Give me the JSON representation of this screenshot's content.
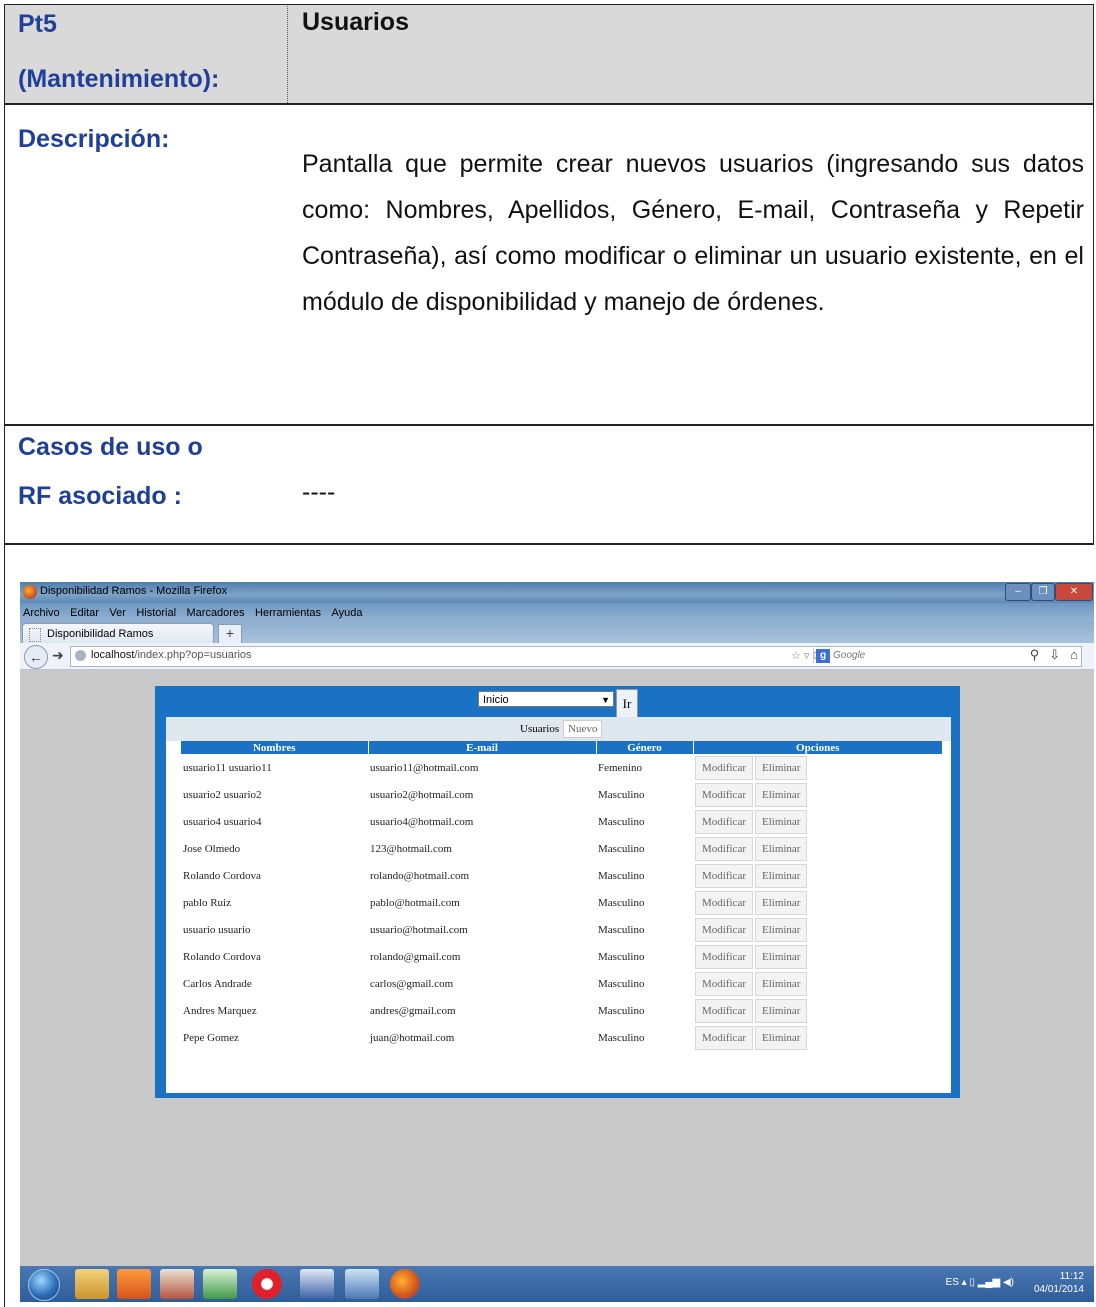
{
  "document": {
    "pt_label_line1": "Pt5",
    "pt_label_line2": "(Mantenimiento):",
    "title": "Usuarios",
    "desc_label": "Descripción:",
    "description": "Pantalla que permite crear nuevos usuarios (ingresando sus datos como: Nombres, Apellidos, Género, E-mail, Contraseña y Repetir Contraseña), así como modificar o eliminar un usuario existente, en el módulo de disponibilidad y manejo de órdenes.",
    "rf_label_line1": "Casos de uso o",
    "rf_label_line2": "RF asociado :",
    "rf_value": "----"
  },
  "browser": {
    "window_title": "Disponibilidad Ramos - Mozilla Firefox",
    "menu": [
      "Archivo",
      "Editar",
      "Ver",
      "Historial",
      "Marcadores",
      "Herramientas",
      "Ayuda"
    ],
    "tab_label": "Disponibilidad Ramos",
    "url_host": "localhost",
    "url_path": "/index.php?op=usuarios",
    "search_placeholder": "Google"
  },
  "app": {
    "menu_select_value": "Inicio",
    "go_button": "Ir",
    "subtabs": [
      "Usuarios",
      "Nuevo"
    ],
    "columns": [
      "Nombres",
      "E-mail",
      "Género",
      "Opciones"
    ],
    "modify_label": "Modificar",
    "delete_label": "Eliminar",
    "rows": [
      {
        "nombre": "usuario11 usuario11",
        "email": "usuario11@hotmail.com",
        "genero": "Femenino"
      },
      {
        "nombre": "usuario2 usuario2",
        "email": "usuario2@hotmail.com",
        "genero": "Masculino"
      },
      {
        "nombre": "usuario4 usuario4",
        "email": "usuario4@hotmail.com",
        "genero": "Masculino"
      },
      {
        "nombre": "Jose Olmedo",
        "email": "123@hotmail.com",
        "genero": "Masculino"
      },
      {
        "nombre": "Rolando Cordova",
        "email": "rolando@hotmail.com",
        "genero": "Masculino"
      },
      {
        "nombre": "pablo Ruiz",
        "email": "pablo@hotmail.com",
        "genero": "Masculino"
      },
      {
        "nombre": "usuario usuario",
        "email": "usuario@hotmail.com",
        "genero": "Masculino"
      },
      {
        "nombre": "Rolando Cordova",
        "email": "rolando@gmail.com",
        "genero": "Masculino"
      },
      {
        "nombre": "Carlos Andrade",
        "email": "carlos@gmail.com",
        "genero": "Masculino"
      },
      {
        "nombre": "Andres Marquez",
        "email": "andres@gmail.com",
        "genero": "Masculino"
      },
      {
        "nombre": "Pepe Gomez",
        "email": "juan@hotmail.com",
        "genero": "Masculino"
      }
    ]
  },
  "taskbar": {
    "language": "ES",
    "time": "11:12",
    "date": "04/01/2014"
  }
}
